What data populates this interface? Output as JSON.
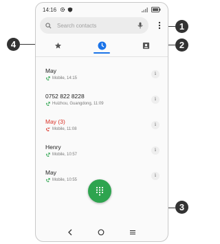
{
  "status": {
    "time": "14:16"
  },
  "search": {
    "placeholder": "Search contacts"
  },
  "calls": [
    {
      "name": "May",
      "detail": "Mobile, 14:15",
      "missed": false
    },
    {
      "name": "0752 822 8228",
      "detail": "Huizhou, Guangdong, 11:09",
      "missed": false
    },
    {
      "name": "May (3)",
      "detail": "Mobile, 11:08",
      "missed": true
    },
    {
      "name": "Henry",
      "detail": "Mobile, 10:57",
      "missed": false
    },
    {
      "name": "May",
      "detail": "Mobile, 10:55",
      "missed": false
    }
  ],
  "info_label": "i",
  "callouts": [
    "1",
    "2",
    "3",
    "4"
  ],
  "colors": {
    "accent": "#1a73e8",
    "fab": "#2ea44f",
    "missed": "#d93025",
    "outgoing": "#2ea44f"
  },
  "icons": {
    "status": [
      "settings-icon",
      "shield-icon",
      "signal-icon",
      "battery-icon"
    ],
    "tabs": [
      "star-icon",
      "clock-icon",
      "contacts-icon"
    ],
    "nav": [
      "back-icon",
      "home-icon",
      "recents-icon"
    ]
  }
}
